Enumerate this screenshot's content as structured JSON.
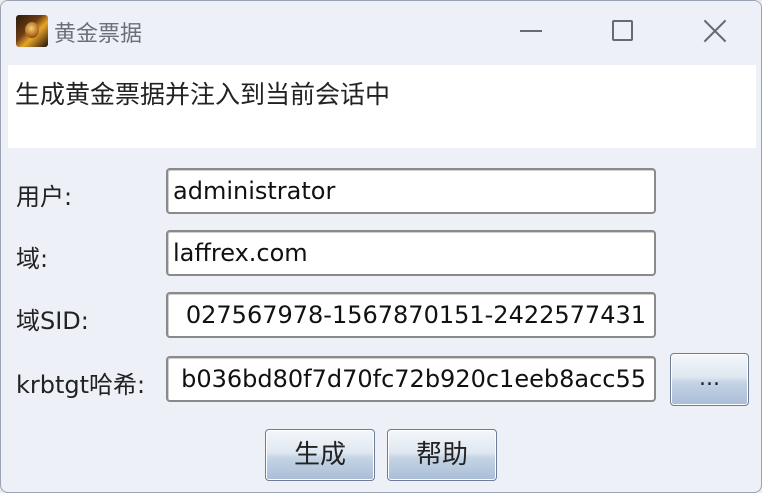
{
  "window": {
    "title": "黄金票据"
  },
  "description": "生成黄金票据并注入到当前会话中",
  "form": {
    "user_label": "用户:",
    "user_value": "administrator",
    "domain_label": "域:",
    "domain_value": "laffrex.com",
    "sid_label": "域SID:",
    "sid_value": "027567978-1567870151-2422577431",
    "hash_label": "krbtgt哈希:",
    "hash_value": "b036bd80f7d70fc72b920c1eeb8acc55",
    "browse_label": "..."
  },
  "buttons": {
    "generate": "生成",
    "help": "帮助"
  },
  "icons": {
    "app": "app-icon",
    "minimize": "minimize-icon",
    "maximize": "maximize-icon",
    "close": "close-icon"
  }
}
